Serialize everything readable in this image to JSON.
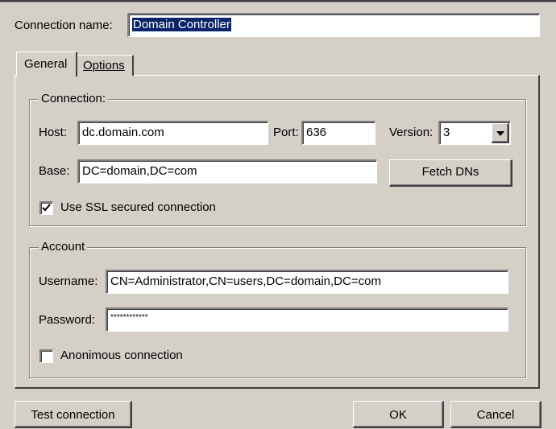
{
  "connection_name": {
    "label": "Connection name:",
    "value": "Domain Controller"
  },
  "tabs": [
    {
      "label": "General",
      "active": true
    },
    {
      "label": "Options",
      "active": false
    }
  ],
  "connection_group": {
    "title": "Connection:",
    "host_label": "Host:",
    "host_value": "dc.domain.com",
    "port_label": "Port:",
    "port_value": "636",
    "version_label": "Version:",
    "version_value": "3",
    "base_label": "Base:",
    "base_value": "DC=domain,DC=com",
    "fetch_dns_label": "Fetch DNs",
    "ssl_label": "Use SSL secured connection",
    "ssl_checked": true
  },
  "account_group": {
    "title": "Account",
    "username_label": "Username:",
    "username_value": "CN=Administrator,CN=users,DC=domain,DC=com",
    "password_label": "Password:",
    "password_value": "************",
    "anon_label": "Anonimous connection",
    "anon_checked": false
  },
  "buttons": {
    "test_label": "Test connection",
    "ok_label": "OK",
    "cancel_label": "Cancel"
  }
}
